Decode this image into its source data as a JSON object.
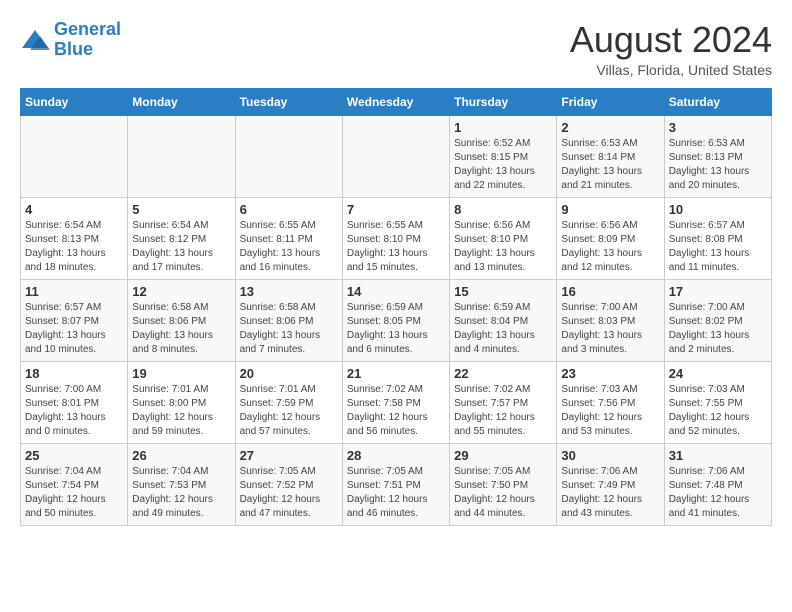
{
  "header": {
    "logo_line1": "General",
    "logo_line2": "Blue",
    "title": "August 2024",
    "subtitle": "Villas, Florida, United States"
  },
  "days_of_week": [
    "Sunday",
    "Monday",
    "Tuesday",
    "Wednesday",
    "Thursday",
    "Friday",
    "Saturday"
  ],
  "weeks": [
    [
      {
        "day": "",
        "info": ""
      },
      {
        "day": "",
        "info": ""
      },
      {
        "day": "",
        "info": ""
      },
      {
        "day": "",
        "info": ""
      },
      {
        "day": "1",
        "info": "Sunrise: 6:52 AM\nSunset: 8:15 PM\nDaylight: 13 hours\nand 22 minutes."
      },
      {
        "day": "2",
        "info": "Sunrise: 6:53 AM\nSunset: 8:14 PM\nDaylight: 13 hours\nand 21 minutes."
      },
      {
        "day": "3",
        "info": "Sunrise: 6:53 AM\nSunset: 8:13 PM\nDaylight: 13 hours\nand 20 minutes."
      }
    ],
    [
      {
        "day": "4",
        "info": "Sunrise: 6:54 AM\nSunset: 8:13 PM\nDaylight: 13 hours\nand 18 minutes."
      },
      {
        "day": "5",
        "info": "Sunrise: 6:54 AM\nSunset: 8:12 PM\nDaylight: 13 hours\nand 17 minutes."
      },
      {
        "day": "6",
        "info": "Sunrise: 6:55 AM\nSunset: 8:11 PM\nDaylight: 13 hours\nand 16 minutes."
      },
      {
        "day": "7",
        "info": "Sunrise: 6:55 AM\nSunset: 8:10 PM\nDaylight: 13 hours\nand 15 minutes."
      },
      {
        "day": "8",
        "info": "Sunrise: 6:56 AM\nSunset: 8:10 PM\nDaylight: 13 hours\nand 13 minutes."
      },
      {
        "day": "9",
        "info": "Sunrise: 6:56 AM\nSunset: 8:09 PM\nDaylight: 13 hours\nand 12 minutes."
      },
      {
        "day": "10",
        "info": "Sunrise: 6:57 AM\nSunset: 8:08 PM\nDaylight: 13 hours\nand 11 minutes."
      }
    ],
    [
      {
        "day": "11",
        "info": "Sunrise: 6:57 AM\nSunset: 8:07 PM\nDaylight: 13 hours\nand 10 minutes."
      },
      {
        "day": "12",
        "info": "Sunrise: 6:58 AM\nSunset: 8:06 PM\nDaylight: 13 hours\nand 8 minutes."
      },
      {
        "day": "13",
        "info": "Sunrise: 6:58 AM\nSunset: 8:06 PM\nDaylight: 13 hours\nand 7 minutes."
      },
      {
        "day": "14",
        "info": "Sunrise: 6:59 AM\nSunset: 8:05 PM\nDaylight: 13 hours\nand 6 minutes."
      },
      {
        "day": "15",
        "info": "Sunrise: 6:59 AM\nSunset: 8:04 PM\nDaylight: 13 hours\nand 4 minutes."
      },
      {
        "day": "16",
        "info": "Sunrise: 7:00 AM\nSunset: 8:03 PM\nDaylight: 13 hours\nand 3 minutes."
      },
      {
        "day": "17",
        "info": "Sunrise: 7:00 AM\nSunset: 8:02 PM\nDaylight: 13 hours\nand 2 minutes."
      }
    ],
    [
      {
        "day": "18",
        "info": "Sunrise: 7:00 AM\nSunset: 8:01 PM\nDaylight: 13 hours\nand 0 minutes."
      },
      {
        "day": "19",
        "info": "Sunrise: 7:01 AM\nSunset: 8:00 PM\nDaylight: 12 hours\nand 59 minutes."
      },
      {
        "day": "20",
        "info": "Sunrise: 7:01 AM\nSunset: 7:59 PM\nDaylight: 12 hours\nand 57 minutes."
      },
      {
        "day": "21",
        "info": "Sunrise: 7:02 AM\nSunset: 7:58 PM\nDaylight: 12 hours\nand 56 minutes."
      },
      {
        "day": "22",
        "info": "Sunrise: 7:02 AM\nSunset: 7:57 PM\nDaylight: 12 hours\nand 55 minutes."
      },
      {
        "day": "23",
        "info": "Sunrise: 7:03 AM\nSunset: 7:56 PM\nDaylight: 12 hours\nand 53 minutes."
      },
      {
        "day": "24",
        "info": "Sunrise: 7:03 AM\nSunset: 7:55 PM\nDaylight: 12 hours\nand 52 minutes."
      }
    ],
    [
      {
        "day": "25",
        "info": "Sunrise: 7:04 AM\nSunset: 7:54 PM\nDaylight: 12 hours\nand 50 minutes."
      },
      {
        "day": "26",
        "info": "Sunrise: 7:04 AM\nSunset: 7:53 PM\nDaylight: 12 hours\nand 49 minutes."
      },
      {
        "day": "27",
        "info": "Sunrise: 7:05 AM\nSunset: 7:52 PM\nDaylight: 12 hours\nand 47 minutes."
      },
      {
        "day": "28",
        "info": "Sunrise: 7:05 AM\nSunset: 7:51 PM\nDaylight: 12 hours\nand 46 minutes."
      },
      {
        "day": "29",
        "info": "Sunrise: 7:05 AM\nSunset: 7:50 PM\nDaylight: 12 hours\nand 44 minutes."
      },
      {
        "day": "30",
        "info": "Sunrise: 7:06 AM\nSunset: 7:49 PM\nDaylight: 12 hours\nand 43 minutes."
      },
      {
        "day": "31",
        "info": "Sunrise: 7:06 AM\nSunset: 7:48 PM\nDaylight: 12 hours\nand 41 minutes."
      }
    ]
  ]
}
